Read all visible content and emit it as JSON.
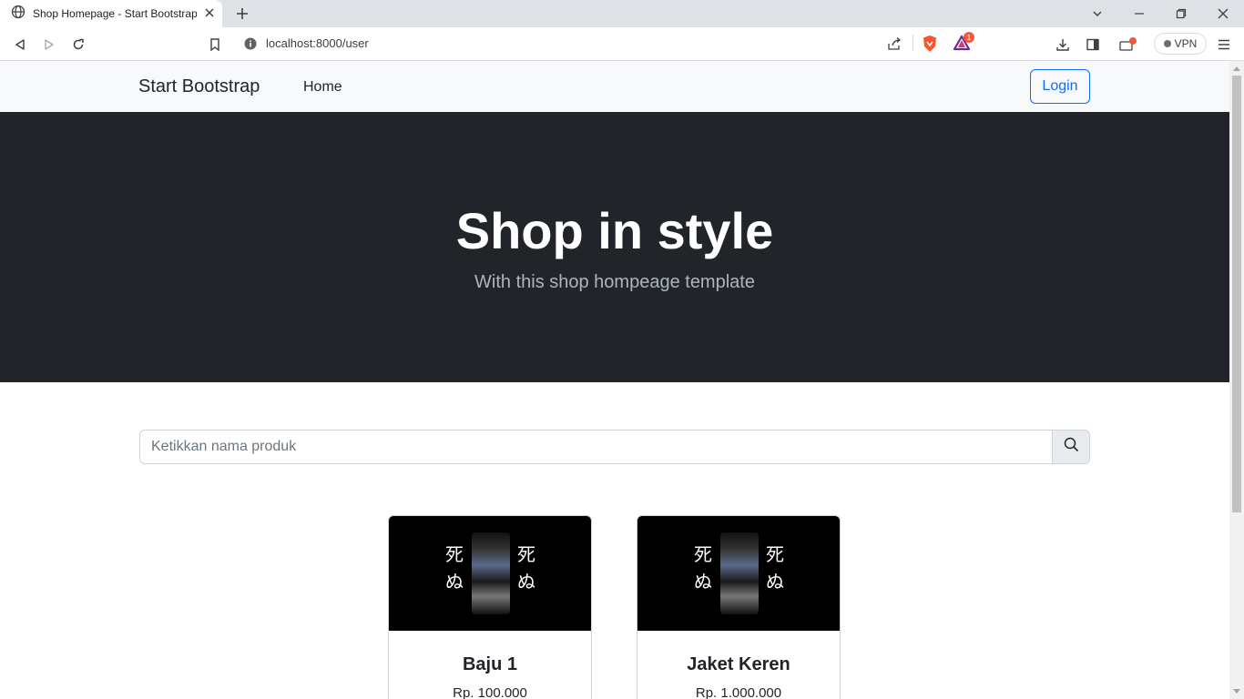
{
  "browser": {
    "tab_title": "Shop Homepage - Start Bootstrap",
    "url": "localhost:8000/user",
    "vpn_label": "VPN",
    "notification_badge": "1"
  },
  "navbar": {
    "brand": "Start Bootstrap",
    "home": "Home",
    "login": "Login"
  },
  "hero": {
    "title": "Shop in style",
    "subtitle": "With this shop hompeage template"
  },
  "search": {
    "placeholder": "Ketikkan nama produk"
  },
  "products": [
    {
      "name": "Baju 1",
      "price": "Rp. 100.000",
      "image_text_left": [
        "死",
        "ぬ"
      ],
      "image_text_right": [
        "死",
        "ぬ"
      ]
    },
    {
      "name": "Jaket Keren",
      "price": "Rp. 1.000.000",
      "image_text_left": [
        "死",
        "ぬ"
      ],
      "image_text_right": [
        "死",
        "ぬ"
      ]
    }
  ],
  "colors": {
    "hero_bg": "#212529",
    "primary": "#0d6efd",
    "navbar_bg": "#f8f9fa"
  }
}
